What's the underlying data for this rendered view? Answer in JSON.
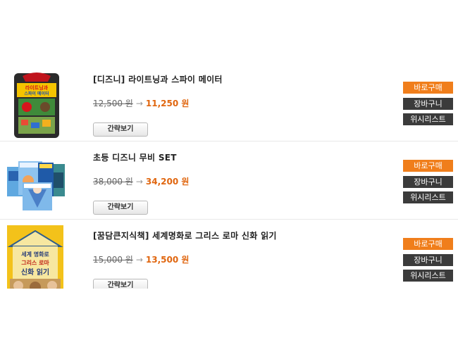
{
  "products": [
    {
      "title": "[디즈니] 라이트닝과 스파이 메이터",
      "original_price": "12,500 원",
      "arrow": "→",
      "sale_price": "11,250 원",
      "preview_label": "간략보기",
      "buy_label": "바로구매",
      "cart_label": "장바구니",
      "wishlist_label": "위시리스트",
      "cover_text": [
        "라이트닝과",
        "스파이 메이터"
      ]
    },
    {
      "title": "초등 디즈니 무비 SET",
      "original_price": "38,000 원",
      "arrow": "→",
      "sale_price": "34,200 원",
      "preview_label": "간략보기",
      "buy_label": "바로구매",
      "cart_label": "장바구니",
      "wishlist_label": "위시리스트"
    },
    {
      "title": "[꿈담큰지식책] 세계명화로 그리스 로마 신화 읽기",
      "original_price": "15,000 원",
      "arrow": "→",
      "sale_price": "13,500 원",
      "preview_label": "간략보기",
      "buy_label": "바로구매",
      "cart_label": "장바구니",
      "wishlist_label": "위시리스트",
      "cover_text": [
        "세계 명화로",
        "그리스 로마",
        "신화 읽기"
      ]
    }
  ],
  "colors": {
    "buy": "#f07e1b",
    "dark": "#3b3b3b",
    "sale": "#e0660f"
  }
}
